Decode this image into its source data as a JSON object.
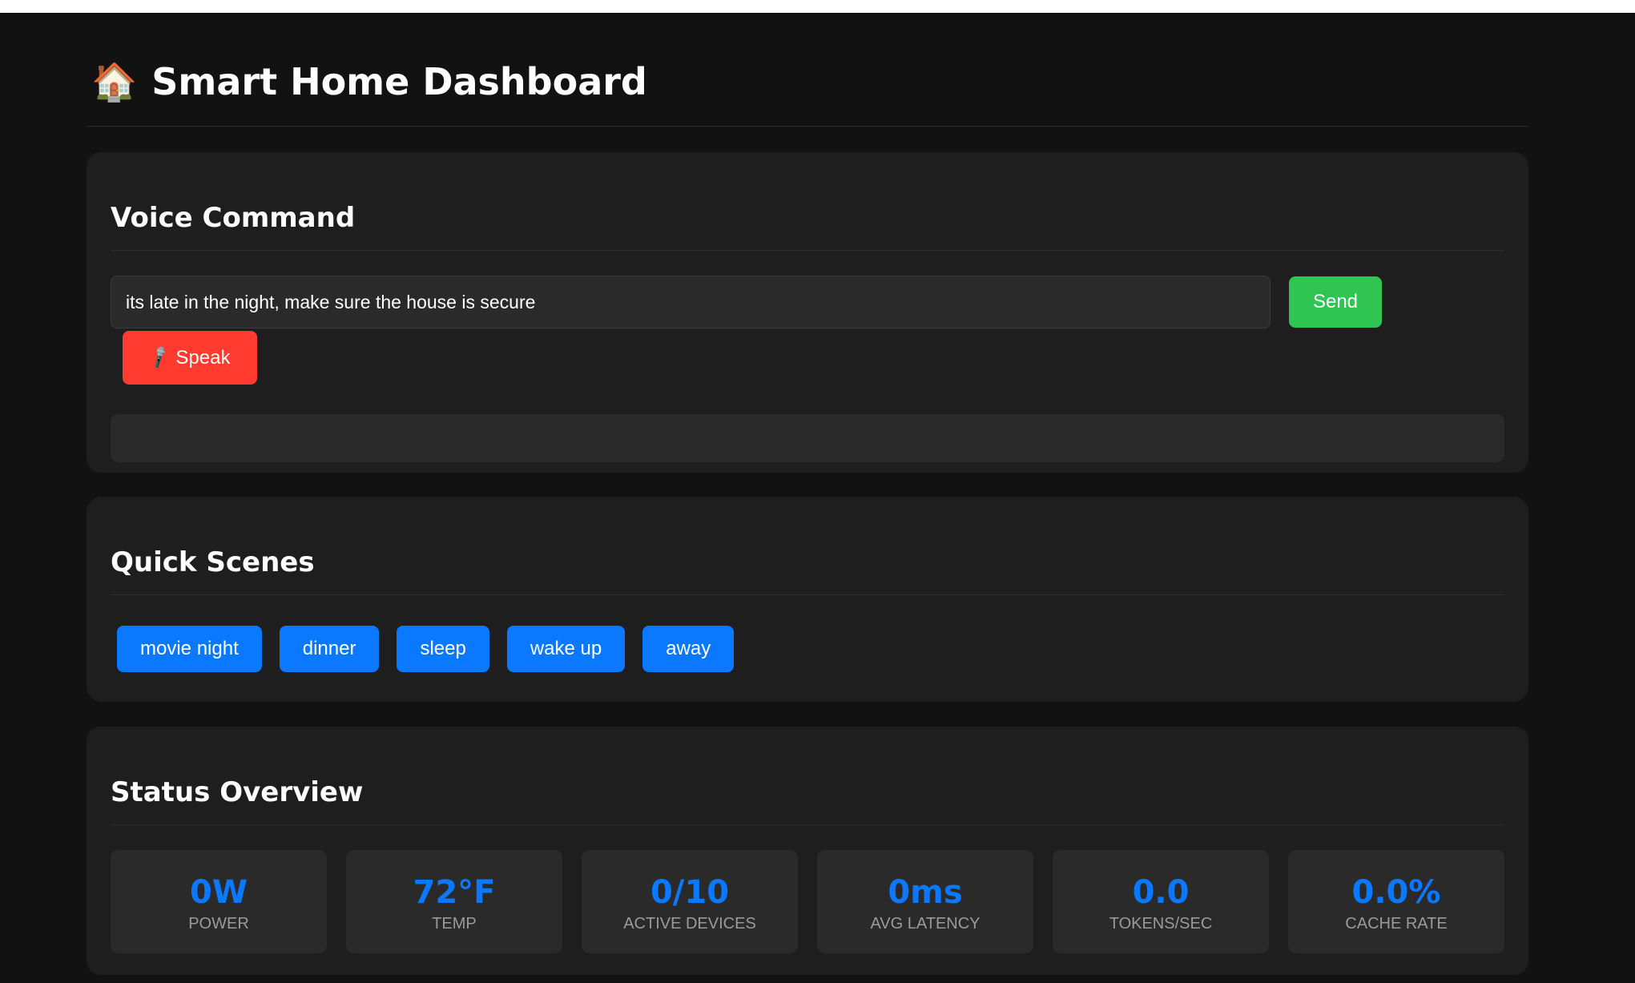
{
  "header": {
    "icon": "house-icon",
    "title": "Smart Home Dashboard"
  },
  "voice": {
    "title": "Voice Command",
    "input_value": "its late in the night, make sure the house is secure",
    "send_label": "Send",
    "speak_label": "Speak",
    "speak_icon": "microphone-icon",
    "response_text": ""
  },
  "scenes": {
    "title": "Quick Scenes",
    "items": [
      {
        "label": "movie night"
      },
      {
        "label": "dinner"
      },
      {
        "label": "sleep"
      },
      {
        "label": "wake up"
      },
      {
        "label": "away"
      }
    ]
  },
  "status": {
    "title": "Status Overview",
    "tiles": [
      {
        "value": "0W",
        "label": "Power"
      },
      {
        "value": "72°F",
        "label": "Temp"
      },
      {
        "value": "0/10",
        "label": "Active Devices"
      },
      {
        "value": "0ms",
        "label": "Avg Latency"
      },
      {
        "value": "0.0",
        "label": "Tokens/sec"
      },
      {
        "value": "0.0%",
        "label": "Cache Rate"
      }
    ]
  },
  "colors": {
    "background": "#121212",
    "card": "#1e1e1e",
    "accent_blue": "#0a78ff",
    "send_green": "#30c452",
    "speak_red": "#ff3b30"
  }
}
